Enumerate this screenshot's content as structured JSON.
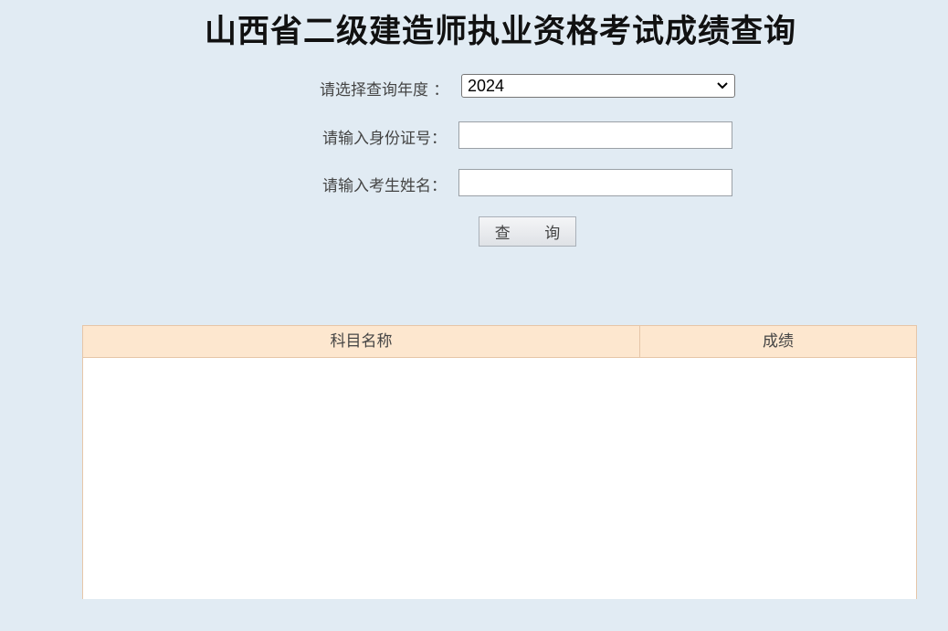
{
  "page": {
    "title": "山西省二级建造师执业资格考试成绩查询"
  },
  "form": {
    "year_label": "请选择查询年度 ：",
    "year_selected": "2024",
    "id_label": "请输入身份证号：",
    "id_value": "",
    "name_label": "请输入考生姓名：",
    "name_value": "",
    "submit_label": "查 询"
  },
  "results": {
    "columns": [
      "科目名称",
      "成绩"
    ],
    "rows": []
  },
  "icons": {
    "select_arrow": "chevron-down-icon"
  }
}
